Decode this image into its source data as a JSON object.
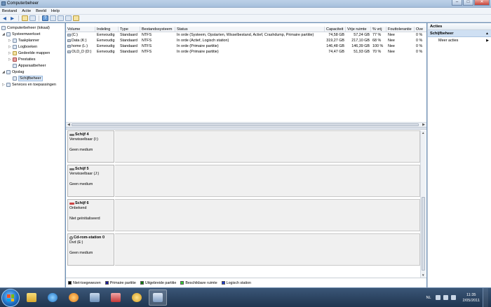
{
  "window": {
    "title": "Computerbeheer"
  },
  "menu": [
    "Bestand",
    "Actie",
    "Beeld",
    "Help"
  ],
  "tree": {
    "root": "Computerbeheer (lokaal)",
    "systeemwerkset": "Systeemwerkset",
    "taakplanner": "Taakplanner",
    "logboeken": "Logboeken",
    "gedeelde_mappen": "Gedeelde mappen",
    "prestaties": "Prestaties",
    "apparaatbeheer": "Apparaatbeheer",
    "opslag": "Opslag",
    "schijfbeheer": "Schijfbeheer",
    "services": "Services en toepassingen"
  },
  "volume_table": {
    "headers": [
      "Volume",
      "Indeling",
      "Type",
      "Bestandssysteem",
      "Status",
      "Capaciteit",
      "Vrije ruimte",
      "% vrij",
      "Fouttolerantie",
      "Ove"
    ],
    "rows": [
      [
        "(C:)",
        "Eenvoudig",
        "Standaard",
        "NTFS",
        "In orde (Systeem, Opstarten, Wisselbestand, Actief, Crashdump, Primaire partitie)",
        "74,58 GB",
        "57,24 GB",
        "77 %",
        "Nee",
        "0 %"
      ],
      [
        "Data (K:)",
        "Eenvoudig",
        "Standaard",
        "NTFS",
        "In orde (Actief, Logisch station)",
        "319,27 GB",
        "217,10 GB",
        "68 %",
        "Nee",
        "0 %"
      ],
      [
        "home (L:)",
        "Eenvoudig",
        "Standaard",
        "NTFS",
        "In orde (Primaire partitie)",
        "146,48 GB",
        "146,39 GB",
        "100 %",
        "Nee",
        "0 %"
      ],
      [
        "OLD_D (D:)",
        "Eenvoudig",
        "Standaard",
        "NTFS",
        "In orde (Primaire partitie)",
        "74,47 GB",
        "51,93 GB",
        "70 %",
        "Nee",
        "0 %"
      ]
    ]
  },
  "disks": [
    {
      "name": "Schijf 4",
      "type": "Verwisselbaar (I:)",
      "state": "Geen medium",
      "icon": "disk-icon"
    },
    {
      "name": "Schijf 5",
      "type": "Verwisselbaar (J:)",
      "state": "Geen medium",
      "icon": "disk-icon"
    },
    {
      "name": "Schijf 6",
      "type": "Onbekend",
      "state": "Niet geïnitialiseerd",
      "icon": "disk-warning-icon"
    },
    {
      "name": "Cd-rom-station 0",
      "type": "Dvd (E:)",
      "state": "Geen medium",
      "icon": "cdrom-icon"
    }
  ],
  "legend": [
    {
      "label": "Niet-toegewezen",
      "color": "#000000"
    },
    {
      "label": "Primaire partitie",
      "color": "#1c1c9c"
    },
    {
      "label": "Uitgebreide partitie",
      "color": "#0f7a0f"
    },
    {
      "label": "Beschikbare ruimte",
      "color": "#33cc33"
    },
    {
      "label": "Logisch station",
      "color": "#1c3cd0"
    }
  ],
  "actions": {
    "header": "Acties",
    "section": "Schijfbeheer",
    "more": "Meer acties"
  },
  "taskbar": {
    "lang": "NL",
    "time": "11:35",
    "date": "2/05/2011"
  }
}
